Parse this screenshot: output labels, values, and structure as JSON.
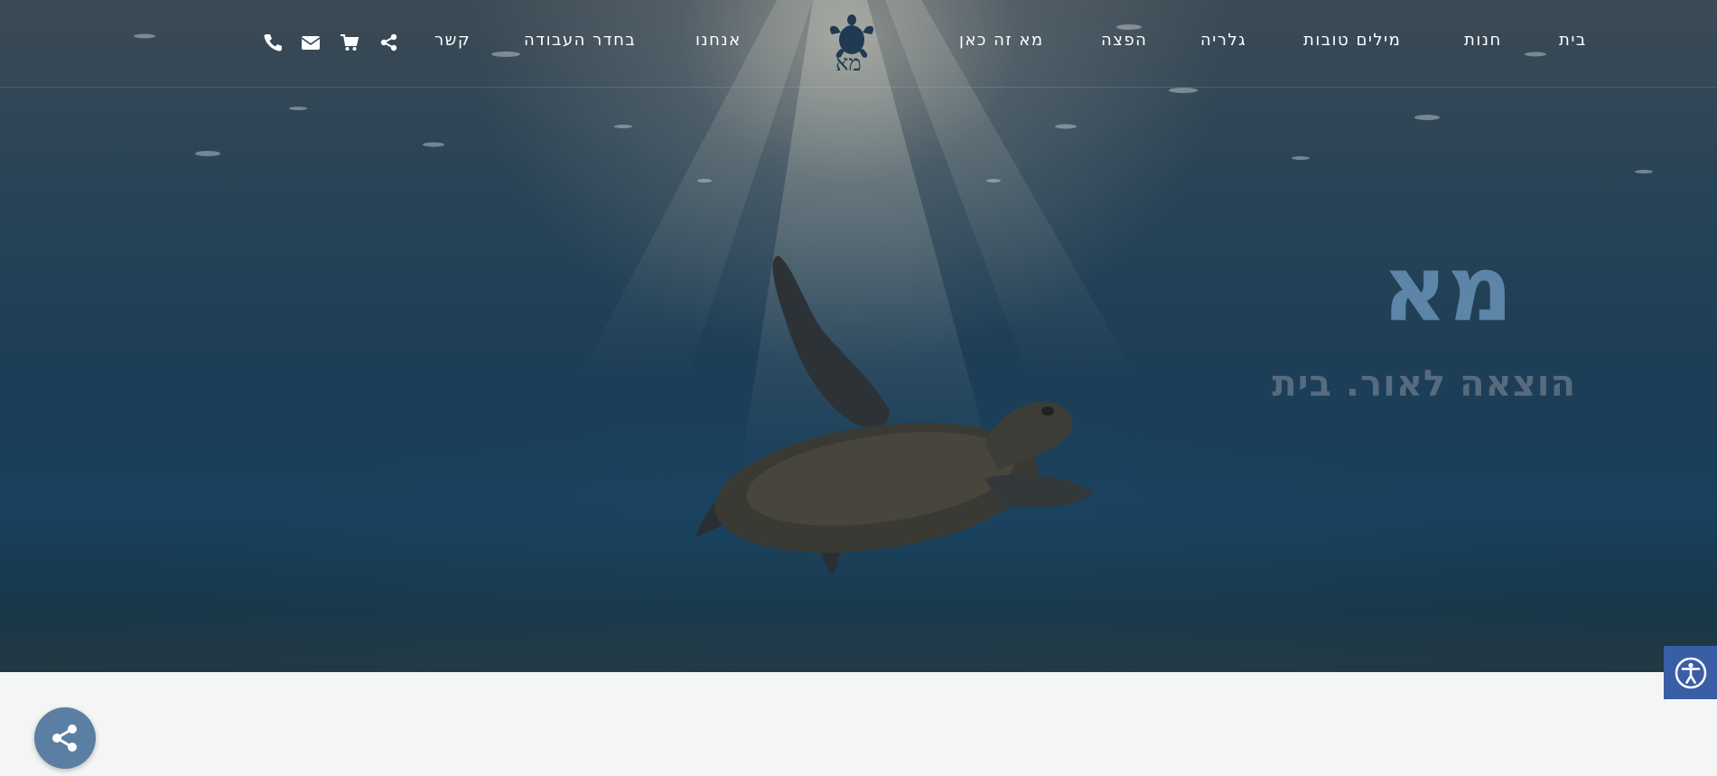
{
  "nav": {
    "items": [
      {
        "label": "בית"
      },
      {
        "label": "חנות"
      },
      {
        "label": "מילים טובות"
      },
      {
        "label": "גלריה"
      },
      {
        "label": "הפצה"
      },
      {
        "label": "מא זה כאן"
      },
      {
        "label": "אנחנו"
      },
      {
        "label": "בחדר העבודה"
      },
      {
        "label": "קשר"
      }
    ],
    "icons": [
      "share-icon",
      "cart-icon",
      "envelope-icon",
      "phone-icon"
    ]
  },
  "logo": {
    "text": "מא",
    "icon": "turtle-icon"
  },
  "hero": {
    "title": "מא",
    "subtitle": "הוצאה לאור. בית"
  },
  "widgets": {
    "accessibility_icon": "accessibility-icon",
    "share_fab_icon": "share-icon"
  },
  "colors": {
    "accessibility_bg": "#3a5ea6",
    "share_fab_bg": "#5b7fa2",
    "hero_title": "#5c85a8",
    "hero_subtitle": "#566b7e"
  }
}
